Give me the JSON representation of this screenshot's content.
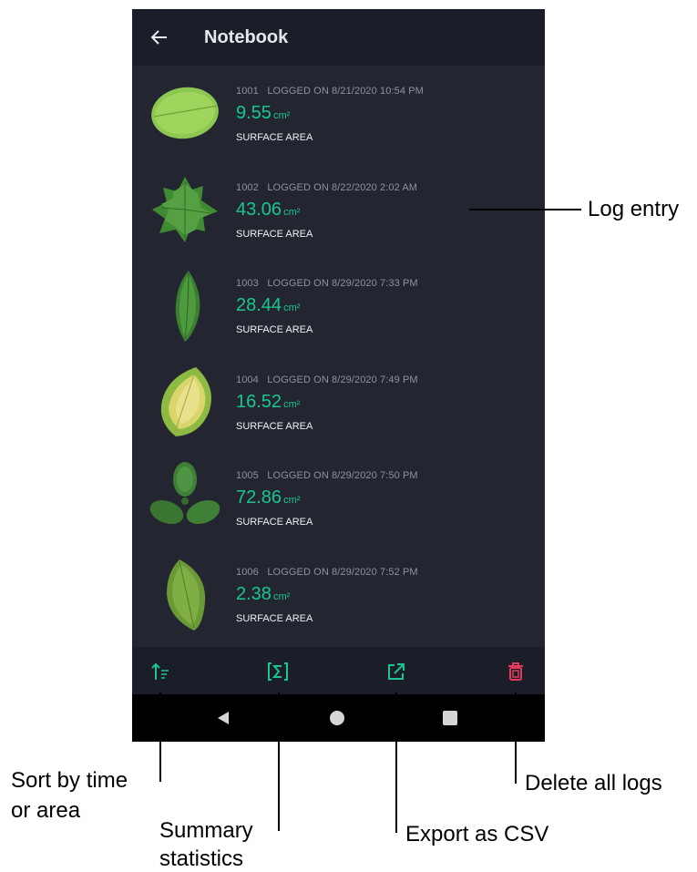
{
  "appbar": {
    "back_icon": "arrow-left-icon",
    "title": "Notebook"
  },
  "entries": [
    {
      "id": "1001",
      "logged": "LOGGED ON 8/21/2020 10:54 PM",
      "value": "9.55",
      "unit": "cm²",
      "label": "SURFACE AREA",
      "leaf": "oval-leaf"
    },
    {
      "id": "1002",
      "logged": "LOGGED ON 8/22/2020 2:02 AM",
      "value": "43.06",
      "unit": "cm²",
      "label": "SURFACE AREA",
      "leaf": "lobed-leaf"
    },
    {
      "id": "1003",
      "logged": "LOGGED ON 8/29/2020 7:33 PM",
      "value": "28.44",
      "unit": "cm²",
      "label": "SURFACE AREA",
      "leaf": "narrow-leaf"
    },
    {
      "id": "1004",
      "logged": "LOGGED ON 8/29/2020 7:49 PM",
      "value": "16.52",
      "unit": "cm²",
      "label": "SURFACE AREA",
      "leaf": "yellowing-leaf"
    },
    {
      "id": "1005",
      "logged": "LOGGED ON 8/29/2020 7:50 PM",
      "value": "72.86",
      "unit": "cm²",
      "label": "SURFACE AREA",
      "leaf": "trifoliate-leaf"
    },
    {
      "id": "1006",
      "logged": "LOGGED ON 8/29/2020 7:52 PM",
      "value": "2.38",
      "unit": "cm²",
      "label": "SURFACE AREA",
      "leaf": "oval-leaf"
    }
  ],
  "toolbar": {
    "sort_icon": "sort-icon",
    "summary_icon": "sigma-icon",
    "export_icon": "export-icon",
    "delete_icon": "trash-icon"
  },
  "navbar": {
    "back": "nav-back-icon",
    "home": "nav-home-icon",
    "recents": "nav-recents-icon"
  },
  "annotations": {
    "log_entry": "Log entry",
    "sort_line1": "Sort by time",
    "sort_line2": "or area",
    "summary_line1": "Summary",
    "summary_line2": "statistics",
    "export": "Export as CSV",
    "delete": "Delete all logs"
  },
  "colors": {
    "accent_green": "#19c68f",
    "delete_red": "#e23b58",
    "background": "#232631",
    "bar": "#1b1e29"
  }
}
